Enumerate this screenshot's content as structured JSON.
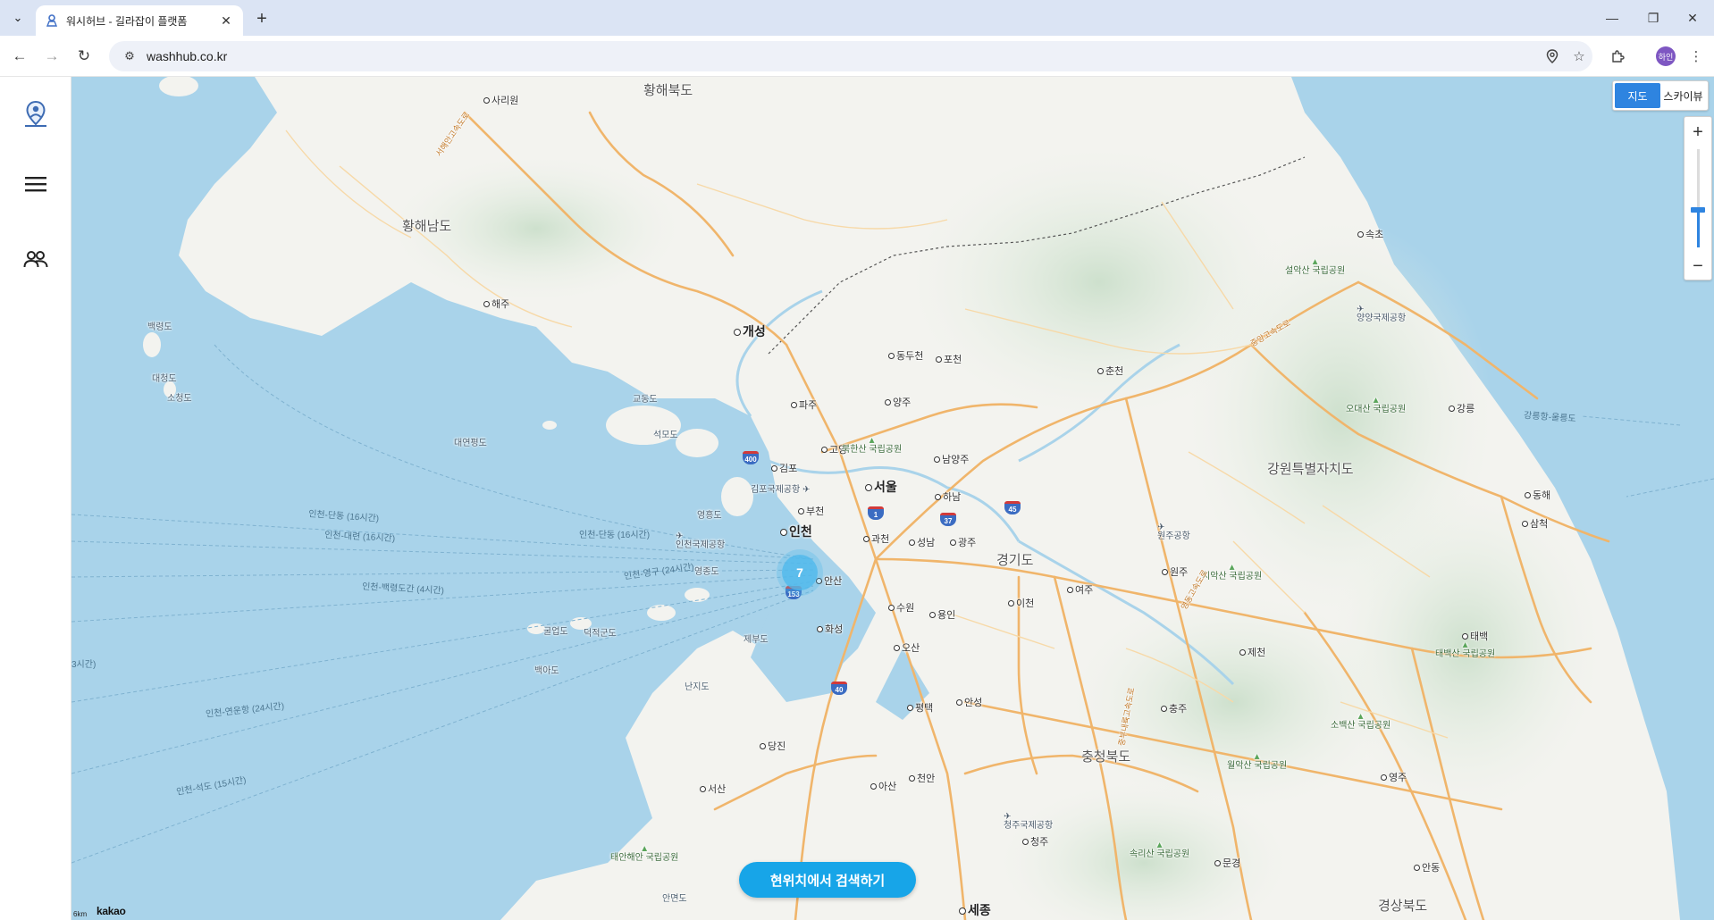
{
  "browser": {
    "tab_title": "워시허브 - 길라잡이 플랫폼",
    "url": "washhub.co.kr",
    "profile_label": "하인"
  },
  "sidebar": {
    "items": [
      {
        "icon": "location-person-icon"
      },
      {
        "icon": "hamburger-menu-icon"
      },
      {
        "icon": "users-icon"
      }
    ]
  },
  "map": {
    "type_toggle": {
      "map": "지도",
      "skyview": "스카이뷰"
    },
    "zoom": {
      "in": "+",
      "out": "−",
      "level": 0.38
    },
    "cluster_count": "7",
    "search_button": "현위치에서 검색하기",
    "scale": "6km",
    "brand": "kakao",
    "regions": [
      "황해북도",
      "황해남도",
      "강원특별자치도",
      "경기도",
      "충청북도",
      "경상북도"
    ],
    "cities": [
      "사리원",
      "해주",
      "개성",
      "동두천",
      "포천",
      "춘천",
      "파주",
      "양주",
      "고양",
      "김포",
      "남양주",
      "서울",
      "부천",
      "하남",
      "인천",
      "과천",
      "성남",
      "광주",
      "안산",
      "수원",
      "용인",
      "이천",
      "여주",
      "원주",
      "화성",
      "오산",
      "평택",
      "안성",
      "충주",
      "제천",
      "태백",
      "당진",
      "서산",
      "아산",
      "천안",
      "청주",
      "세종",
      "속초",
      "강릉",
      "동해",
      "삼척",
      "영주",
      "문경",
      "안동"
    ],
    "islands": [
      "백령도",
      "대청도",
      "소청도",
      "교동도",
      "석모도",
      "대연평도",
      "영흥도",
      "영종도",
      "덕적군도",
      "굴업도",
      "백아도",
      "제부도",
      "난지도",
      "안면도"
    ],
    "parks": [
      "설악산 국립공원",
      "오대산 국립공원",
      "북한산 국립공원",
      "치악산 국립공원",
      "태백산 국립공원",
      "소백산 국립공원",
      "월악산 국립공원",
      "속리산 국립공원",
      "태안해안 국립공원"
    ],
    "airports": [
      "김포국제공항",
      "인천국제공항",
      "양양국제공항",
      "원주공항",
      "청주국제공항"
    ],
    "sea_routes": [
      "인천-단동 (16시간)",
      "인천-대련 (16시간)",
      "인천-단동 (16시간)",
      "인천-영구 (24시간)",
      "인천-백령도간 (4시간)",
      "인천-연운항 (24시간)",
      "인천-석도 (15시간)",
      "강릉항-울릉도",
      "3시간)"
    ],
    "expressways": [
      "서해안고속도로",
      "중부내륙고속도로",
      "영동고속도로",
      "중앙고속도로"
    ],
    "route_shields": [
      "400",
      "1",
      "37",
      "45",
      "153",
      "40"
    ]
  }
}
